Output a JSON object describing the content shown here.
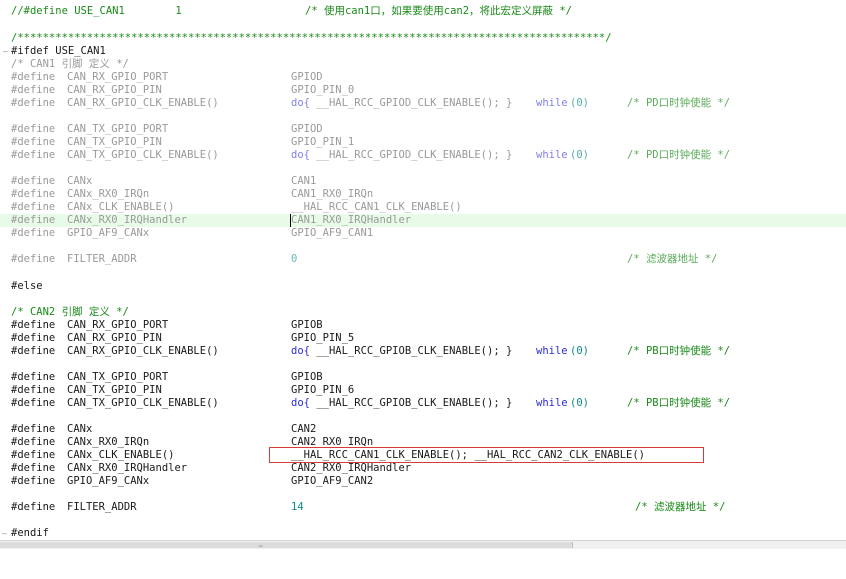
{
  "lines": [
    {
      "y": 5,
      "style": "cm",
      "cols": [
        "//#define USE_CAN1        1",
        "",
        "",
        ""
      ],
      "c2": "/* 使用can1口，如果要使用can2，将此宏定义屏蔽 */"
    },
    {
      "y": 32,
      "style": "cm",
      "full": "/*********************************************************************************************/"
    },
    {
      "y": 45,
      "style": "bl",
      "full": "#ifdef USE_CAN1",
      "fold": true
    },
    {
      "y": 58,
      "style": "gr",
      "full": "/* CAN1 引脚 定义 */"
    }
  ],
  "code": {
    "header_comment": "//#define USE_CAN1        1",
    "header_note": "/* 使用can1口，如果要使用can2，将此宏定义屏蔽 */",
    "separator": "/*********************************************************************************************/",
    "ifdef": "#ifdef USE_CAN1",
    "can1_comment": "/* CAN1 引脚 定义 */",
    "define_kw": "#define",
    "rx_port_name": "CAN_RX_GPIO_PORT",
    "rx_pin_name": "CAN_RX_GPIO_PIN",
    "rx_clk_name": "CAN_RX_GPIO_CLK_ENABLE()",
    "tx_port_name": "CAN_TX_GPIO_PORT",
    "tx_pin_name": "CAN_TX_GPIO_PIN",
    "tx_clk_name": "CAN_TX_GPIO_CLK_ENABLE()",
    "canx_name": "CANx",
    "irq_name": "CANx_RX0_IRQn",
    "canclk_name": "CANx_CLK_ENABLE()",
    "handler_name": "CANx_RX0_IRQHandler",
    "af_name": "GPIO_AF9_CANx",
    "filter_name": "FILTER_ADDR",
    "can1": {
      "rx_port": "GPIOD",
      "rx_pin": "GPIO_PIN_0",
      "rx_clk_do": "do{",
      "rx_clk_mid": " __HAL_RCC_GPIOD_CLK_ENABLE(); }",
      "while": "while",
      "rx_clk_end": "(0)",
      "rx_clk_comment": "/* PD口时钟使能 */",
      "tx_port": "GPIOD",
      "tx_pin": "GPIO_PIN_1",
      "tx_clk_mid": " __HAL_RCC_GPIOD_CLK_ENABLE(); }",
      "tx_clk_comment": "/* PD口时钟使能 */",
      "canx": "CAN1",
      "irq": "CAN1_RX0_IRQn",
      "clk": "__HAL_RCC_CAN1_CLK_ENABLE()",
      "handler": "CAN1_RX0_IRQHandler",
      "af": "GPIO_AF9_CAN1",
      "filter": "0",
      "filter_comment": "/* 滤波器地址 */"
    },
    "else": "#else",
    "can2_comment": "/* CAN2 引脚 定义 */",
    "can2": {
      "rx_port": "GPIOB",
      "rx_pin": "GPIO_PIN_5",
      "rx_clk_mid": " __HAL_RCC_GPIOB_CLK_ENABLE(); }",
      "rx_clk_comment": "/* PB口时钟使能 */",
      "tx_port": "GPIOB",
      "tx_pin": "GPIO_PIN_6",
      "tx_clk_mid": " __HAL_RCC_GPIOB_CLK_ENABLE(); }",
      "tx_clk_comment": "/* PB口时钟使能 */",
      "canx": "CAN2",
      "irq": "CAN2_RX0_IRQn",
      "clk": "__HAL_RCC_CAN1_CLK_ENABLE(); __HAL_RCC_CAN2_CLK_ENABLE()",
      "handler": "CAN2_RX0_IRQHandler",
      "af": "GPIO_AF9_CAN2",
      "filter": "14",
      "filter_comment": "/* 滤波器地址 */"
    },
    "endif": "#endif"
  },
  "colors": {
    "comment": "#1a8a1a",
    "inactive": "#9a9a9a",
    "keyword": "#2b2bd6",
    "number": "#0a8a8a",
    "highlight_line": "#e8fbe8",
    "annotation_box": "#d83a3a"
  },
  "scrollbar_grip_icon": "grip-dots-icon"
}
